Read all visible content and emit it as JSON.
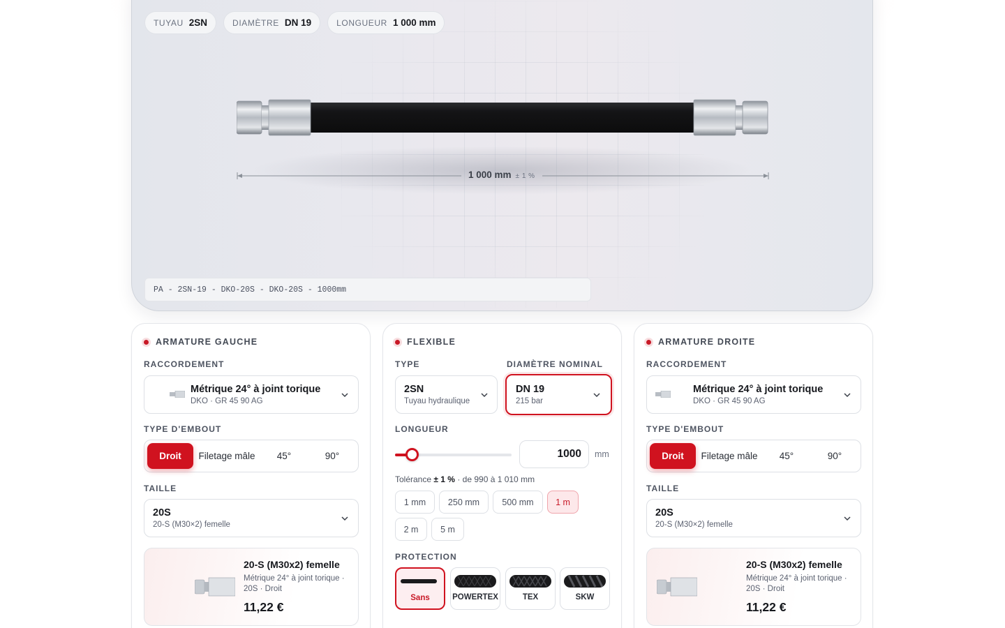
{
  "hero": {
    "chips": [
      {
        "key": "TUYAU",
        "value": "2SN"
      },
      {
        "key": "DIAMÈTRE",
        "value": "DN 19"
      },
      {
        "key": "LONGUEUR",
        "value": "1 000 mm"
      }
    ],
    "dimension": {
      "value": "1 000 mm",
      "tolerance": "± 1 %"
    },
    "reference": "PA - 2SN-19 - DKO-20S - DKO-20S - 1000mm"
  },
  "left": {
    "title": "ARMATURE GAUCHE",
    "raccordement_label": "RACCORDEMENT",
    "raccordement": {
      "main": "Métrique 24° à joint torique",
      "sub": "DKO · GR 45 90 AG"
    },
    "type_label": "TYPE D'EMBOUT",
    "types": [
      "Droit",
      "Filetage mâle",
      "45°",
      "90°"
    ],
    "selected_type": "Droit",
    "taille_label": "TAILLE",
    "taille": {
      "main": "20S",
      "sub": "20-S (M30×2) femelle"
    },
    "product": {
      "title": "20-S (M30x2) femelle",
      "desc": "Métrique 24° à joint torique · 20S · Droit",
      "price": "11,22 €"
    }
  },
  "middle": {
    "title": "FLEXIBLE",
    "type_label": "TYPE",
    "type": {
      "main": "2SN",
      "sub": "Tuyau hydraulique"
    },
    "diam_label": "DIAMÈTRE NOMINAL",
    "diam": {
      "main": "DN 19",
      "sub": "215 bar"
    },
    "length_label": "LONGUEUR",
    "length_value": "1000",
    "length_unit": "mm",
    "slider_fraction": 0.12,
    "tolerance": {
      "prefix": "Tolérance",
      "value": "± 1 %",
      "suffix": "· de 990 à 1 010 mm"
    },
    "presets": [
      "1 mm",
      "250 mm",
      "500 mm",
      "1 m",
      "2 m",
      "5 m"
    ],
    "selected_preset": "1 m",
    "protection_label": "PROTECTION",
    "protections": [
      "Sans",
      "POWERTEX",
      "TEX",
      "SKW"
    ],
    "selected_protection": "Sans"
  },
  "right": {
    "title": "ARMATURE DROITE",
    "raccordement_label": "RACCORDEMENT",
    "raccordement": {
      "main": "Métrique 24° à joint torique",
      "sub": "DKO · GR 45 90 AG"
    },
    "type_label": "TYPE D'EMBOUT",
    "types": [
      "Droit",
      "Filetage mâle",
      "45°",
      "90°"
    ],
    "selected_type": "Droit",
    "taille_label": "TAILLE",
    "taille": {
      "main": "20S",
      "sub": "20-S (M30×2) femelle"
    },
    "product": {
      "title": "20-S (M30x2) femelle",
      "desc": "Métrique 24° à joint torique · 20S · Droit",
      "price": "11,22 €"
    }
  },
  "colors": {
    "accent": "#d0121f",
    "accent_soft": "#fde8ea",
    "hose": "#1d1d1f",
    "steel": "#c9cdd3"
  }
}
